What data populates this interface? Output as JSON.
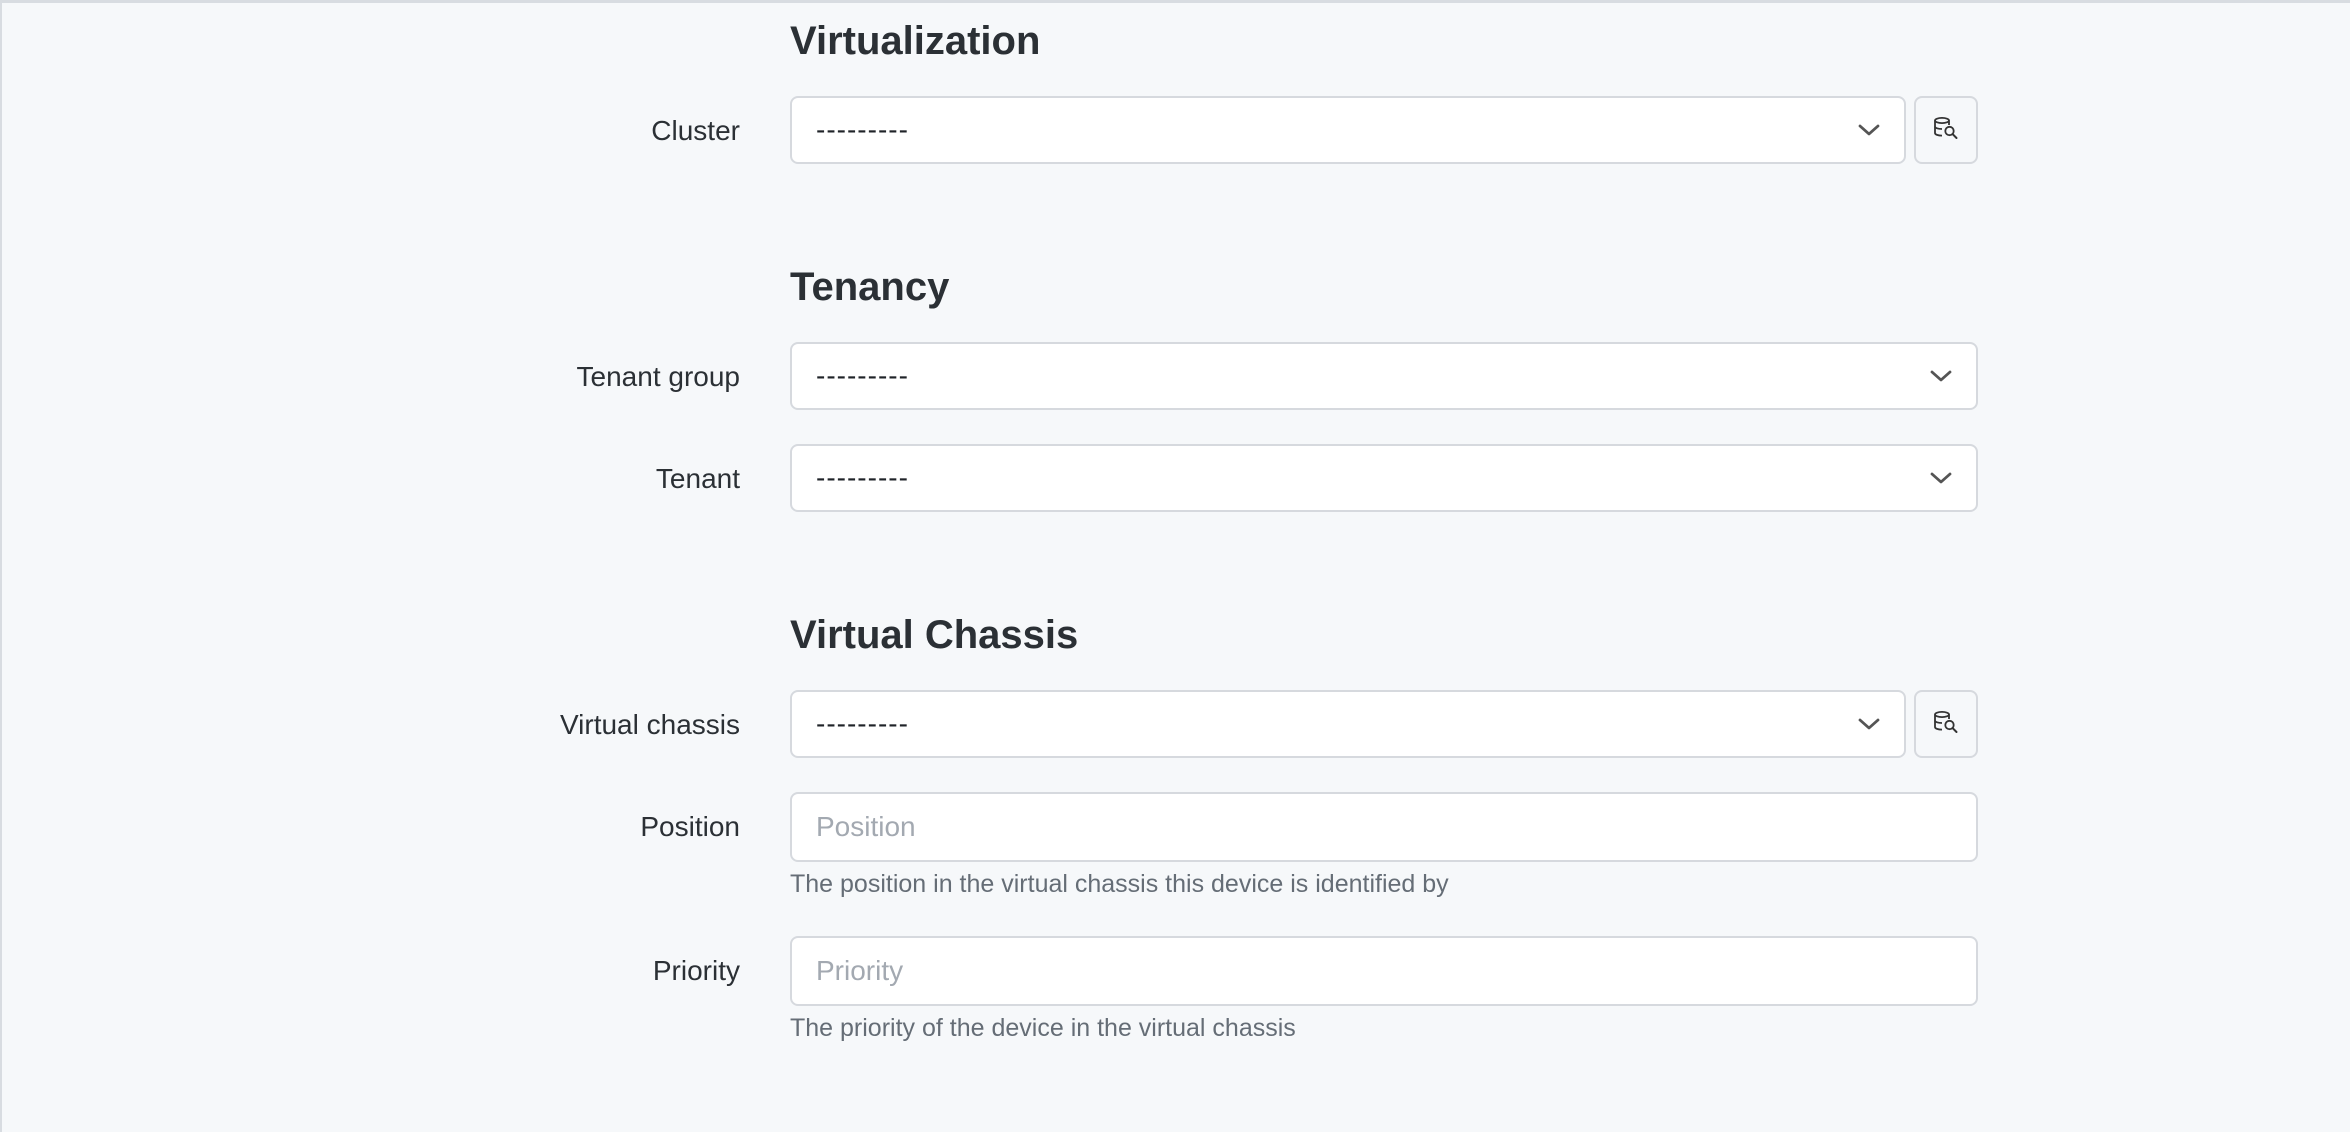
{
  "virtualization": {
    "heading": "Virtualization",
    "cluster": {
      "label": "Cluster",
      "value": "---------"
    }
  },
  "tenancy": {
    "heading": "Tenancy",
    "tenant_group": {
      "label": "Tenant group",
      "value": "---------"
    },
    "tenant": {
      "label": "Tenant",
      "value": "---------"
    }
  },
  "virtual_chassis_section": {
    "heading": "Virtual Chassis",
    "virtual_chassis": {
      "label": "Virtual chassis",
      "value": "---------"
    },
    "position": {
      "label": "Position",
      "placeholder": "Position",
      "help": "The position in the virtual chassis this device is identified by"
    },
    "priority": {
      "label": "Priority",
      "placeholder": "Priority",
      "help": "The priority of the device in the virtual chassis"
    }
  },
  "icons": {
    "chevron": "chevron-down-icon",
    "selector": "selector-search-icon"
  }
}
